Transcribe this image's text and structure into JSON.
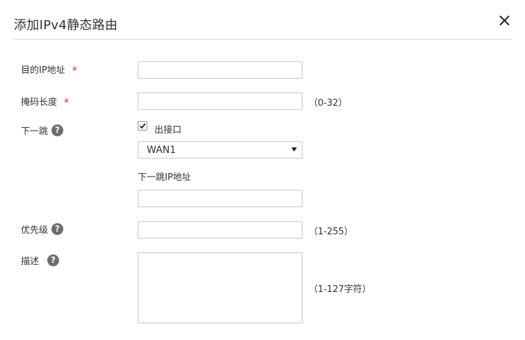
{
  "dialog": {
    "title": "添加IPv4静态路由",
    "close_icon": "close-icon"
  },
  "form": {
    "dest_ip": {
      "label": "目的IP地址",
      "required_mark": "*",
      "value": ""
    },
    "mask_length": {
      "label": "掩码长度",
      "required_mark": "*",
      "value": "",
      "hint": "（0-32）"
    },
    "next_hop": {
      "label": "下一跳",
      "help_icon": "question-icon",
      "help_glyph": "?",
      "outbound_interface_label": "出接口",
      "outbound_interface_checked": true,
      "interface_selected": "WAN1",
      "next_hop_ip_label": "下一跳IP地址",
      "next_hop_ip_value": ""
    },
    "priority": {
      "label": "优先级",
      "help_glyph": "?",
      "value": "",
      "hint": "（1-255）"
    },
    "description": {
      "label": "描述",
      "help_glyph": "?",
      "value": "",
      "hint": "（1-127字符）"
    }
  },
  "colors": {
    "required": "#e02020",
    "border": "#c8c8c8",
    "help_icon_bg": "#6e6e6e",
    "divider": "#d6d6d6"
  }
}
